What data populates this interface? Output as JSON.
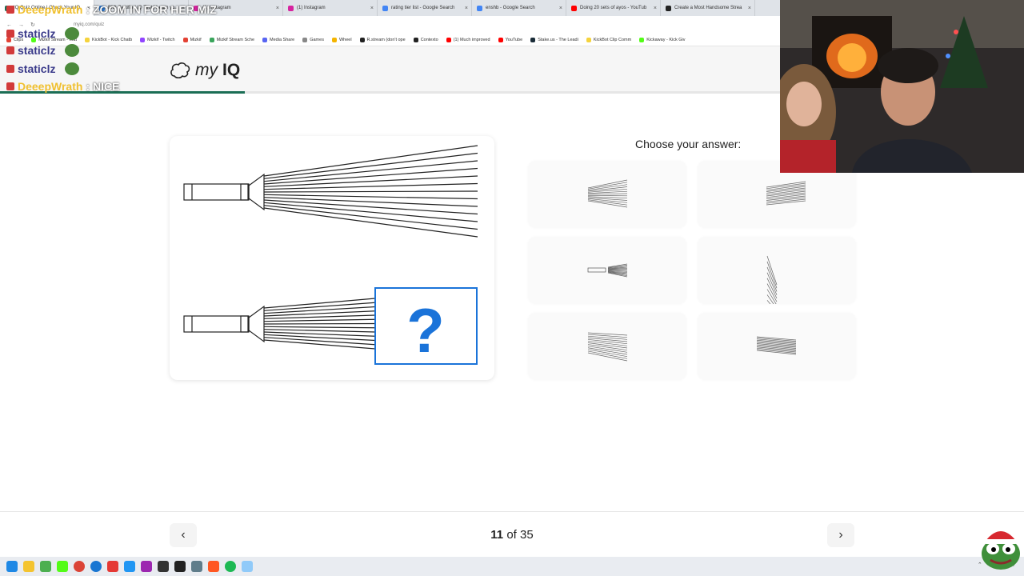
{
  "browser": {
    "tabs": [
      {
        "label": "IQ Quiz Online | Check Your IQ",
        "color": "#1b6e55",
        "active": true
      },
      {
        "label": "BMI Certified IQ Test | Learn yo",
        "color": "#2b7bd8"
      },
      {
        "label": "(1) Instagram",
        "color": "#d6249f"
      },
      {
        "label": "(1) Instagram",
        "color": "#d6249f"
      },
      {
        "label": "rating tier list - Google Search",
        "color": "#4285f4"
      },
      {
        "label": "enshb - Google Search",
        "color": "#4285f4"
      },
      {
        "label": "Doing 20 sets of ayos - YouTub",
        "color": "#ff0000"
      },
      {
        "label": "Create a Most Handsome Strea",
        "color": "#222222"
      }
    ],
    "url": "myiq.com/quiz",
    "bookmarks": [
      {
        "label": "Clips",
        "color": "#e34234"
      },
      {
        "label": "Mizkif Stream - Wat",
        "color": "#53fc18"
      },
      {
        "label": "KickBot - Kick Chatb",
        "color": "#f5d33d"
      },
      {
        "label": "Mizkif - Twitch",
        "color": "#9146ff"
      },
      {
        "label": "Mizkif",
        "color": "#e34234"
      },
      {
        "label": "Mizkif Stream Sche",
        "color": "#3aa55c"
      },
      {
        "label": "Media Share",
        "color": "#5865f2"
      },
      {
        "label": "Games",
        "color": "#888888"
      },
      {
        "label": "Wheel",
        "color": "#f4b400"
      },
      {
        "label": "R.stream (don't ope",
        "color": "#222222"
      },
      {
        "label": "Contexto",
        "color": "#222222"
      },
      {
        "label": "(1) Much improved",
        "color": "#ff0000"
      },
      {
        "label": "YouTube",
        "color": "#ff0000"
      },
      {
        "label": "Stake.us - The Leadi",
        "color": "#1a2c38"
      },
      {
        "label": "KickBot Clip Comm",
        "color": "#f5d33d"
      },
      {
        "label": "Kickaway - Kick Giv",
        "color": "#53fc18"
      }
    ]
  },
  "chat": [
    {
      "name": "DeeepWrath",
      "message": ": ZOOM IN FOR HER MIZ",
      "name_color": "#f0c030"
    },
    {
      "name": "staticlz",
      "message": "",
      "name_color": "#3a3a8a"
    },
    {
      "name": "staticlz",
      "message": "",
      "name_color": "#3a3a8a"
    },
    {
      "name": "staticlz",
      "message": "",
      "name_color": "#3a3a8a"
    },
    {
      "name": "DeeepWrath",
      "message": ": NICE",
      "name_color": "#f0c030"
    }
  ],
  "site": {
    "logo_my": "my",
    "logo_iq": "IQ",
    "progress": 0.314,
    "accent_color": "#1b6e55"
  },
  "quiz": {
    "question_mark": "?",
    "choose_label": "Choose your answer:",
    "options": [
      "option-1",
      "option-2",
      "option-3",
      "option-4",
      "option-5",
      "option-6"
    ],
    "current": "11",
    "of_label": "of",
    "total": "35",
    "prev_icon": "‹",
    "next_icon": "›"
  }
}
